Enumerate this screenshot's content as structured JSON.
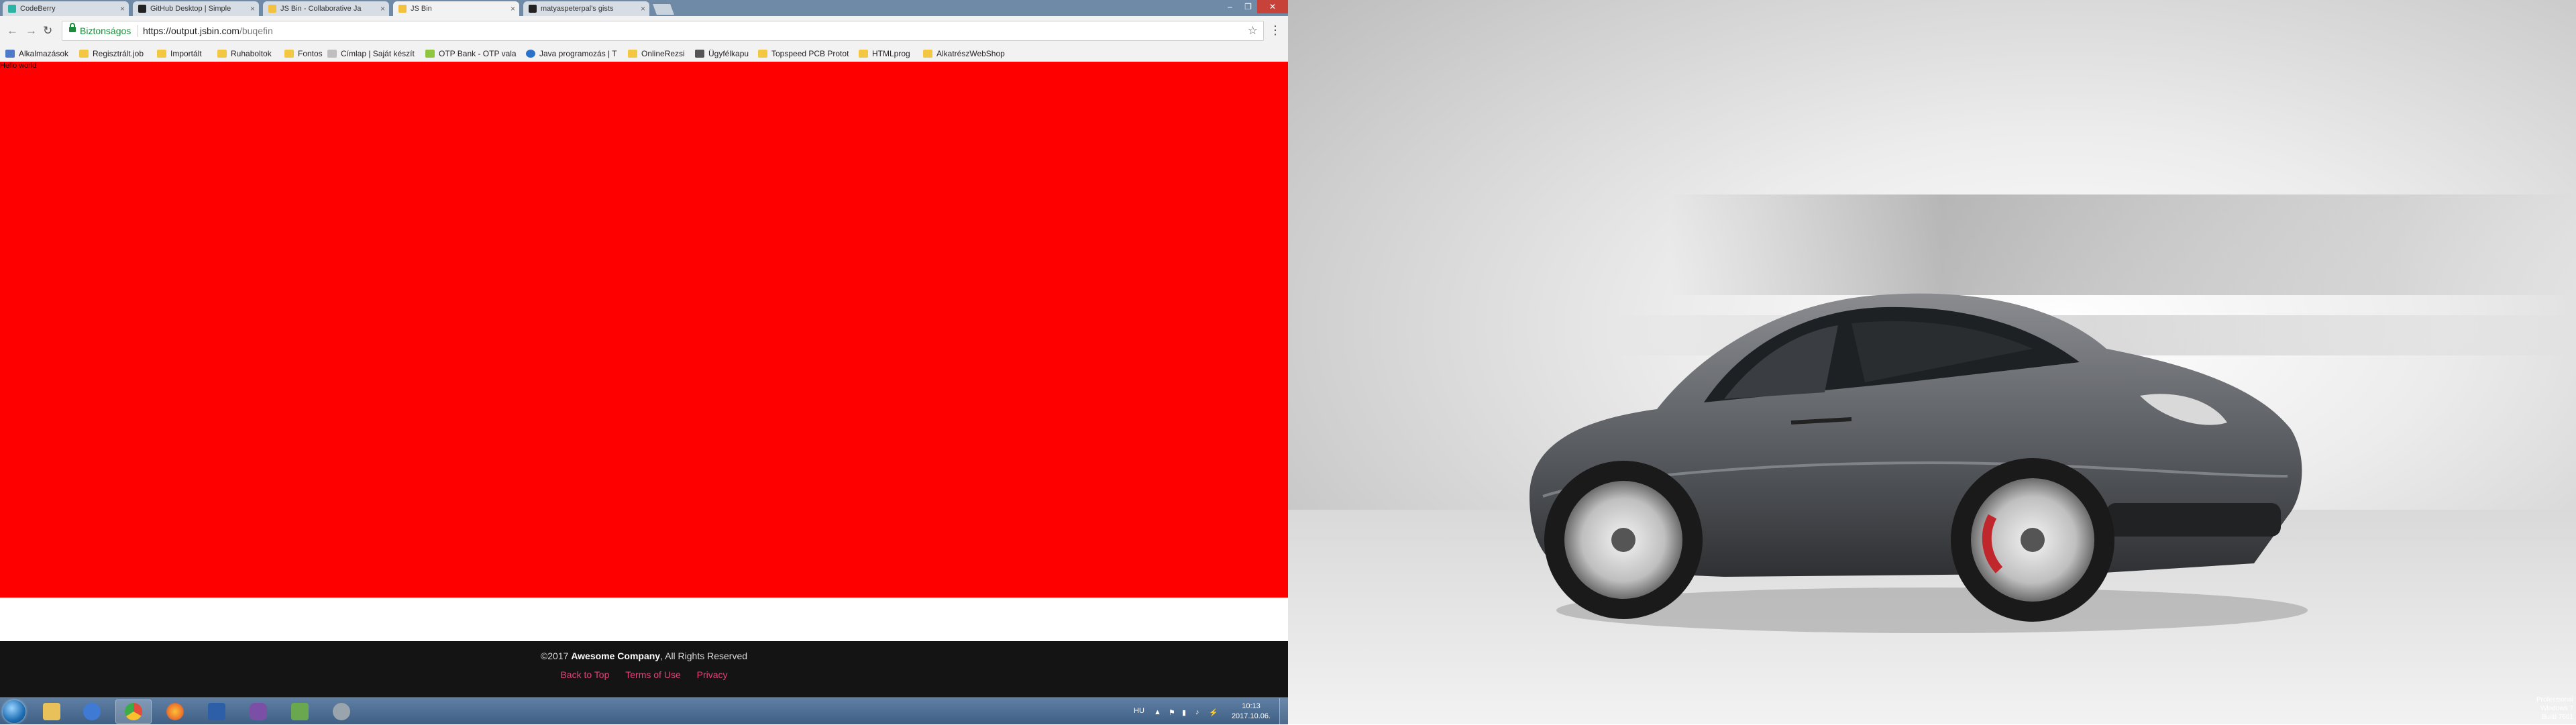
{
  "browser": {
    "tabs": [
      {
        "label": "CodeBerry",
        "icon_color": "#2bb3a3",
        "active": false
      },
      {
        "label": "GitHub Desktop | Simple",
        "icon_color": "#222222",
        "active": false
      },
      {
        "label": "JS Bin - Collaborative Ja",
        "icon_color": "#f2c140",
        "active": false
      },
      {
        "label": "JS Bin",
        "icon_color": "#f2c140",
        "active": true
      },
      {
        "label": "matyaspeterpal's gists",
        "icon_color": "#222222",
        "active": false
      }
    ],
    "tab_close_glyph": "×",
    "window_buttons": {
      "minimize": "–",
      "maximize": "❐",
      "close": "✕"
    },
    "nav": {
      "back": "←",
      "forward": "→",
      "reload": "↻"
    },
    "omnibox": {
      "secure_label": "Biztonságos",
      "url_host": "https://output.jsbin.com",
      "url_path": "/buqefin",
      "star": "☆",
      "menu": "⋮"
    },
    "bookmarks": [
      {
        "label": "Alkalmazások",
        "icon": "apps-grid-icon"
      },
      {
        "label": "Regisztrált.job",
        "icon": "folder-icon"
      },
      {
        "label": "Importált",
        "icon": "folder-icon"
      },
      {
        "label": "Ruhaboltok",
        "icon": "folder-icon"
      },
      {
        "label": "Fontos",
        "icon": "folder-icon"
      },
      {
        "label": "Címlap | Saját készít",
        "icon": "page-icon"
      },
      {
        "label": "OTP Bank - OTP vala",
        "icon": "otp-icon"
      },
      {
        "label": "Java programozás | T",
        "icon": "ie-icon"
      },
      {
        "label": "OnlineRezsi",
        "icon": "folder-icon"
      },
      {
        "label": "Ügyfélkapu",
        "icon": "gov-icon"
      },
      {
        "label": "Topspeed PCB Protot",
        "icon": "folder-icon"
      },
      {
        "label": "HTMLprog",
        "icon": "folder-icon"
      },
      {
        "label": "AlkatrészWebShop",
        "icon": "folder-icon"
      }
    ]
  },
  "page": {
    "top_text": "Hello world",
    "box_color": "#ff0000",
    "footer": {
      "copyright_prefix": "©2017 ",
      "company": "Awesome Company",
      "copyright_suffix": ", All Rights Reserved",
      "links": [
        "Back to Top",
        "Terms of Use",
        "Privacy"
      ]
    }
  },
  "taskbar": {
    "apps": [
      {
        "name": "explorer",
        "color": "#e8c15a"
      },
      {
        "name": "thunderbird",
        "color": "#3f7bd4"
      },
      {
        "name": "chrome",
        "color": "#e34b3a"
      },
      {
        "name": "firefox",
        "color": "#f0762a"
      },
      {
        "name": "floppy",
        "color": "#2c5fa8"
      },
      {
        "name": "viber",
        "color": "#7b4fa6"
      },
      {
        "name": "notepad",
        "color": "#6aa84f"
      },
      {
        "name": "tools",
        "color": "#9aa4ad"
      }
    ],
    "language": "HU",
    "time": "10:13",
    "date": "2017.10.06."
  },
  "desktop": {
    "watermark_lines": [
      "Professional",
      "Windows 7",
      "Build 7601"
    ]
  }
}
